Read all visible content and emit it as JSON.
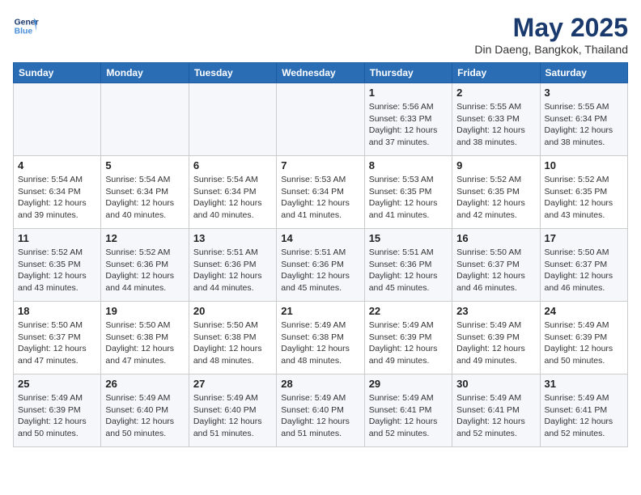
{
  "logo": {
    "line1": "General",
    "line2": "Blue"
  },
  "title": "May 2025",
  "subtitle": "Din Daeng, Bangkok, Thailand",
  "weekdays": [
    "Sunday",
    "Monday",
    "Tuesday",
    "Wednesday",
    "Thursday",
    "Friday",
    "Saturday"
  ],
  "weeks": [
    [
      {
        "day": "",
        "info": ""
      },
      {
        "day": "",
        "info": ""
      },
      {
        "day": "",
        "info": ""
      },
      {
        "day": "",
        "info": ""
      },
      {
        "day": "1",
        "info": "Sunrise: 5:56 AM\nSunset: 6:33 PM\nDaylight: 12 hours\nand 37 minutes."
      },
      {
        "day": "2",
        "info": "Sunrise: 5:55 AM\nSunset: 6:33 PM\nDaylight: 12 hours\nand 38 minutes."
      },
      {
        "day": "3",
        "info": "Sunrise: 5:55 AM\nSunset: 6:34 PM\nDaylight: 12 hours\nand 38 minutes."
      }
    ],
    [
      {
        "day": "4",
        "info": "Sunrise: 5:54 AM\nSunset: 6:34 PM\nDaylight: 12 hours\nand 39 minutes."
      },
      {
        "day": "5",
        "info": "Sunrise: 5:54 AM\nSunset: 6:34 PM\nDaylight: 12 hours\nand 40 minutes."
      },
      {
        "day": "6",
        "info": "Sunrise: 5:54 AM\nSunset: 6:34 PM\nDaylight: 12 hours\nand 40 minutes."
      },
      {
        "day": "7",
        "info": "Sunrise: 5:53 AM\nSunset: 6:34 PM\nDaylight: 12 hours\nand 41 minutes."
      },
      {
        "day": "8",
        "info": "Sunrise: 5:53 AM\nSunset: 6:35 PM\nDaylight: 12 hours\nand 41 minutes."
      },
      {
        "day": "9",
        "info": "Sunrise: 5:52 AM\nSunset: 6:35 PM\nDaylight: 12 hours\nand 42 minutes."
      },
      {
        "day": "10",
        "info": "Sunrise: 5:52 AM\nSunset: 6:35 PM\nDaylight: 12 hours\nand 43 minutes."
      }
    ],
    [
      {
        "day": "11",
        "info": "Sunrise: 5:52 AM\nSunset: 6:35 PM\nDaylight: 12 hours\nand 43 minutes."
      },
      {
        "day": "12",
        "info": "Sunrise: 5:52 AM\nSunset: 6:36 PM\nDaylight: 12 hours\nand 44 minutes."
      },
      {
        "day": "13",
        "info": "Sunrise: 5:51 AM\nSunset: 6:36 PM\nDaylight: 12 hours\nand 44 minutes."
      },
      {
        "day": "14",
        "info": "Sunrise: 5:51 AM\nSunset: 6:36 PM\nDaylight: 12 hours\nand 45 minutes."
      },
      {
        "day": "15",
        "info": "Sunrise: 5:51 AM\nSunset: 6:36 PM\nDaylight: 12 hours\nand 45 minutes."
      },
      {
        "day": "16",
        "info": "Sunrise: 5:50 AM\nSunset: 6:37 PM\nDaylight: 12 hours\nand 46 minutes."
      },
      {
        "day": "17",
        "info": "Sunrise: 5:50 AM\nSunset: 6:37 PM\nDaylight: 12 hours\nand 46 minutes."
      }
    ],
    [
      {
        "day": "18",
        "info": "Sunrise: 5:50 AM\nSunset: 6:37 PM\nDaylight: 12 hours\nand 47 minutes."
      },
      {
        "day": "19",
        "info": "Sunrise: 5:50 AM\nSunset: 6:38 PM\nDaylight: 12 hours\nand 47 minutes."
      },
      {
        "day": "20",
        "info": "Sunrise: 5:50 AM\nSunset: 6:38 PM\nDaylight: 12 hours\nand 48 minutes."
      },
      {
        "day": "21",
        "info": "Sunrise: 5:49 AM\nSunset: 6:38 PM\nDaylight: 12 hours\nand 48 minutes."
      },
      {
        "day": "22",
        "info": "Sunrise: 5:49 AM\nSunset: 6:39 PM\nDaylight: 12 hours\nand 49 minutes."
      },
      {
        "day": "23",
        "info": "Sunrise: 5:49 AM\nSunset: 6:39 PM\nDaylight: 12 hours\nand 49 minutes."
      },
      {
        "day": "24",
        "info": "Sunrise: 5:49 AM\nSunset: 6:39 PM\nDaylight: 12 hours\nand 50 minutes."
      }
    ],
    [
      {
        "day": "25",
        "info": "Sunrise: 5:49 AM\nSunset: 6:39 PM\nDaylight: 12 hours\nand 50 minutes."
      },
      {
        "day": "26",
        "info": "Sunrise: 5:49 AM\nSunset: 6:40 PM\nDaylight: 12 hours\nand 50 minutes."
      },
      {
        "day": "27",
        "info": "Sunrise: 5:49 AM\nSunset: 6:40 PM\nDaylight: 12 hours\nand 51 minutes."
      },
      {
        "day": "28",
        "info": "Sunrise: 5:49 AM\nSunset: 6:40 PM\nDaylight: 12 hours\nand 51 minutes."
      },
      {
        "day": "29",
        "info": "Sunrise: 5:49 AM\nSunset: 6:41 PM\nDaylight: 12 hours\nand 52 minutes."
      },
      {
        "day": "30",
        "info": "Sunrise: 5:49 AM\nSunset: 6:41 PM\nDaylight: 12 hours\nand 52 minutes."
      },
      {
        "day": "31",
        "info": "Sunrise: 5:49 AM\nSunset: 6:41 PM\nDaylight: 12 hours\nand 52 minutes."
      }
    ]
  ]
}
